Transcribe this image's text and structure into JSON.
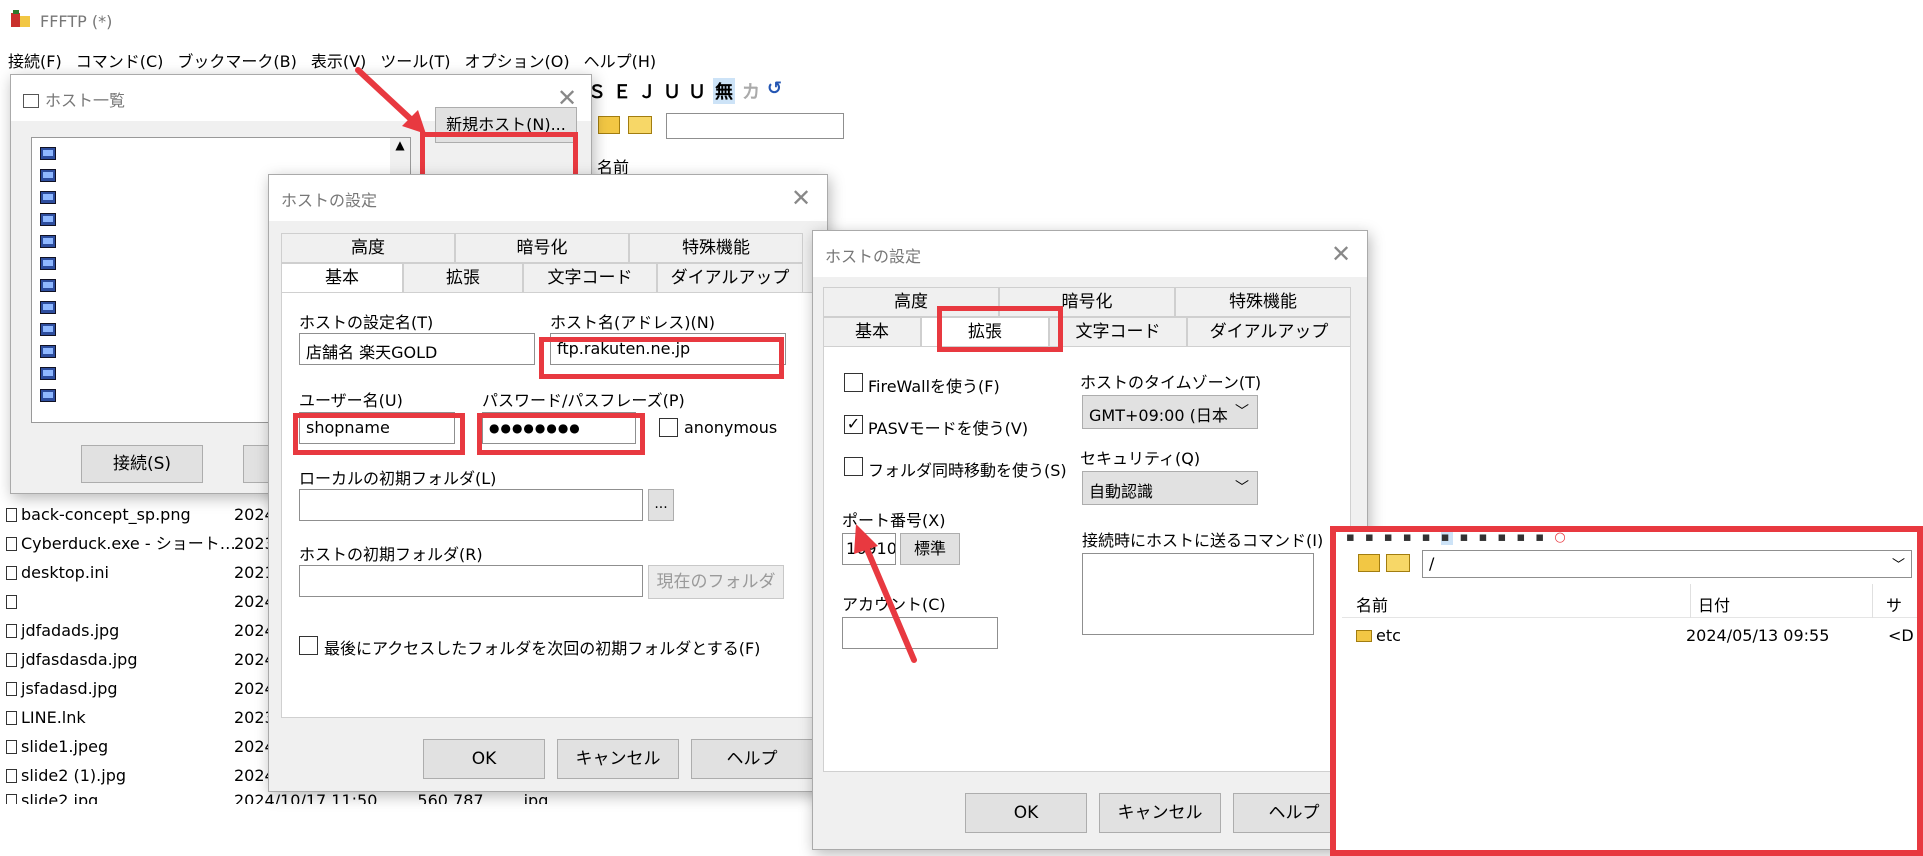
{
  "app": {
    "title": "FFFTP (*)",
    "menu": [
      "接続(F)",
      "コマンド(C)",
      "ブックマーク(B)",
      "表示(V)",
      "ツール(T)",
      "オプション(O)",
      "ヘルプ(H)"
    ],
    "toolbar_glyphs": [
      "Ｓ",
      "Ｅ",
      "Ｊ",
      "Ｕ",
      "Ｕ",
      "無",
      "カ",
      "↺"
    ],
    "column_name": "名前",
    "files": [
      {
        "name": "back-concept_sp.png",
        "date": "2024"
      },
      {
        "name": "Cyberduck.exe - ショート…",
        "date": "2023"
      },
      {
        "name": "desktop.ini",
        "date": "2021"
      },
      {
        "name": "",
        "date": "2024"
      },
      {
        "name": "jdfadads.jpg",
        "date": "2024"
      },
      {
        "name": "jdfasdasda.jpg",
        "date": "2024"
      },
      {
        "name": "jsfadasd.jpg",
        "date": "2024"
      },
      {
        "name": "LINE.lnk",
        "date": "2023"
      },
      {
        "name": "slide1.jpeg",
        "date": "2024"
      },
      {
        "name": "slide2 (1).jpg",
        "date": "2024"
      },
      {
        "name": "slide2.jpg",
        "date": "2024/10/17 11:50",
        "size": "560,787",
        "type": "jpg"
      }
    ]
  },
  "host_list": {
    "title": "ホスト一覧",
    "new_host_button": "新規ホスト(N)...",
    "connect_button": "接続(S)"
  },
  "host_settings_basic": {
    "title": "ホストの設定",
    "tabs_top": [
      "高度",
      "暗号化",
      "特殊機能"
    ],
    "tabs_bottom": [
      "基本",
      "拡張",
      "文字コード",
      "ダイアルアップ"
    ],
    "label_setting_name": "ホストの設定名(T)",
    "value_setting_name": "店舗名 楽天GOLD",
    "label_host_name": "ホスト名(アドレス)(N)",
    "value_host_name": "ftp.rakuten.ne.jp",
    "label_user": "ユーザー名(U)",
    "value_user": "shopname",
    "label_password": "パスワード/パスフレーズ(P)",
    "value_password": "●●●●●●●●",
    "anonymous_label": "anonymous",
    "label_local_folder": "ローカルの初期フォルダ(L)",
    "browse_button": "...",
    "label_host_folder": "ホストの初期フォルダ(R)",
    "current_folder_button": "現在のフォルダ",
    "last_folder_checkbox": "最後にアクセスしたフォルダを次回の初期フォルダとする(F)",
    "ok": "OK",
    "cancel": "キャンセル",
    "help": "ヘルプ"
  },
  "host_settings_ext": {
    "title": "ホストの設定",
    "tabs_top": [
      "高度",
      "暗号化",
      "特殊機能"
    ],
    "tabs_bottom": [
      "基本",
      "拡張",
      "文字コード",
      "ダイアルアップ"
    ],
    "firewall_label": "FireWallを使う(F)",
    "pasv_label": "PASVモードを使う(V)",
    "folder_sync_label": "フォルダ同時移動を使う(S)",
    "timezone_label": "ホストのタイムゾーン(T)",
    "timezone_value": "GMT+09:00 (日本",
    "security_label": "セキュリティ(Q)",
    "security_value": "自動認識",
    "port_label": "ポート番号(X)",
    "port_value": "16910",
    "default_button": "標準",
    "account_label": "アカウント(C)",
    "command_label": "接続時にホストに送るコマンド(I)",
    "ok": "OK",
    "cancel": "キャンセル",
    "help": "ヘルプ"
  },
  "remote_pane": {
    "path": "/",
    "col_name": "名前",
    "col_date": "日付",
    "col_size": "サ",
    "rows": [
      {
        "name": "etc",
        "date": "2024/05/13 09:55",
        "extra": "<D"
      }
    ]
  },
  "accent_color": "#e83940"
}
